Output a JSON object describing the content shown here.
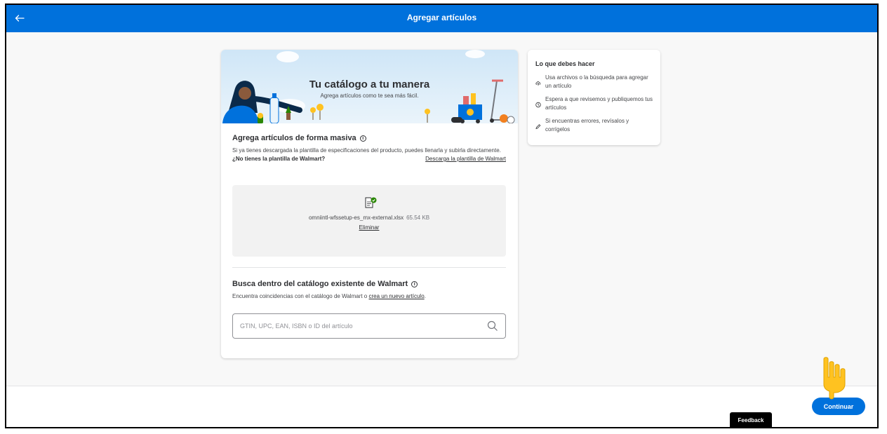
{
  "topbar": {
    "title": "Agregar artículos",
    "back_icon": "arrow-left-icon"
  },
  "banner": {
    "title": "Tu catálogo a tu manera",
    "subtitle": "Agrega artículos como te sea más fácil."
  },
  "bulk": {
    "title": "Agrega artículos de forma masiva",
    "description": "Si ya tienes descargada la plantilla de especificaciones del producto, puedes llenarla y subirla directamente.",
    "no_template_label": "¿No tienes la plantilla de Walmart?",
    "download_link": "Descarga la plantilla de Walmart",
    "file_name": "omniintl-wfssetup-es_mx-external.xlsx",
    "file_size": "65.54 KB",
    "remove_label": "Eliminar"
  },
  "catalog_search": {
    "title": "Busca dentro del catálogo existente de Walmart",
    "description_prefix": "Encuentra coincidencias con el catálogo de Walmart o",
    "create_link": "crea un nuevo artículo",
    "description_suffix": ".",
    "placeholder": "GTIN, UPC, EAN, ISBN o ID del artículo"
  },
  "todo": {
    "title": "Lo que debes hacer",
    "steps": [
      {
        "icon": "cloud-upload-icon",
        "text": "Usa archivos o la búsqueda para agregar un artículo"
      },
      {
        "icon": "clock-icon",
        "text": "Espera a que revisemos y publiquemos tus artículos"
      },
      {
        "icon": "pencil-icon",
        "text": "Si encuentras errores, revísalos y corrígelos"
      }
    ]
  },
  "footer": {
    "continue_label": "Continuar",
    "feedback_label": "Feedback"
  },
  "colors": {
    "brand_blue": "#0071dc",
    "success_green": "#2a8703",
    "spark_yellow": "#ffc220"
  }
}
